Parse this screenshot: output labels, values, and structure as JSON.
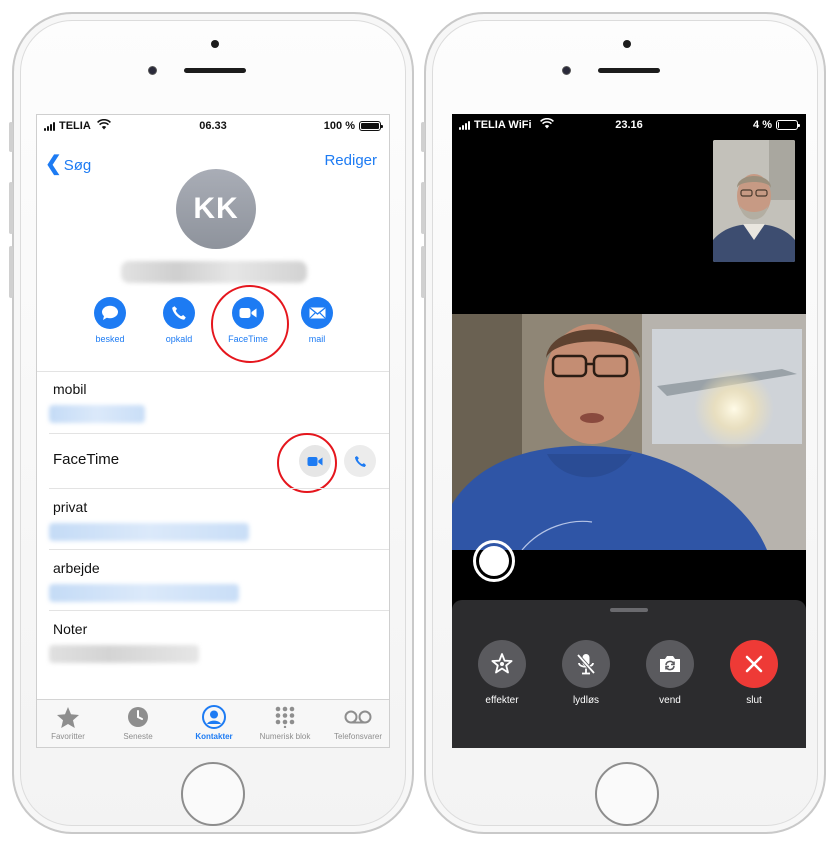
{
  "contact_screen": {
    "status": {
      "carrier": "TELIA",
      "time": "06.33",
      "battery": "100 %",
      "battery_level": 1.0
    },
    "nav": {
      "back_label": "Søg",
      "edit_label": "Rediger"
    },
    "avatar_initials": "KK",
    "actions": [
      {
        "label": "besked",
        "icon": "message-icon"
      },
      {
        "label": "opkald",
        "icon": "phone-icon"
      },
      {
        "label": "FaceTime",
        "icon": "video-icon"
      },
      {
        "label": "mail",
        "icon": "mail-icon"
      }
    ],
    "fields": {
      "mobil": "mobil",
      "facetime": "FaceTime",
      "privat": "privat",
      "arbejde": "arbejde",
      "noter": "Noter"
    },
    "tabs": [
      {
        "label": "Favoritter",
        "icon": "star-icon"
      },
      {
        "label": "Seneste",
        "icon": "clock-icon"
      },
      {
        "label": "Kontakter",
        "icon": "person-icon",
        "active": true
      },
      {
        "label": "Numerisk blok",
        "icon": "keypad-icon"
      },
      {
        "label": "Telefonsvarer",
        "icon": "voicemail-icon"
      }
    ]
  },
  "facetime_screen": {
    "status": {
      "carrier": "TELIA WiFi",
      "time": "23.16",
      "battery": "4 %",
      "battery_level": 0.04
    },
    "controls": [
      {
        "label": "effekter",
        "icon": "effects-icon"
      },
      {
        "label": "lydløs",
        "icon": "mic-off-icon"
      },
      {
        "label": "vend",
        "icon": "flip-camera-icon"
      },
      {
        "label": "slut",
        "icon": "end-call-icon"
      }
    ]
  },
  "colors": {
    "ios_blue": "#1d7bf3",
    "highlight_red": "#e5161d",
    "end_call_red": "#ee3a36",
    "panel_dark": "#2c2c2e"
  }
}
